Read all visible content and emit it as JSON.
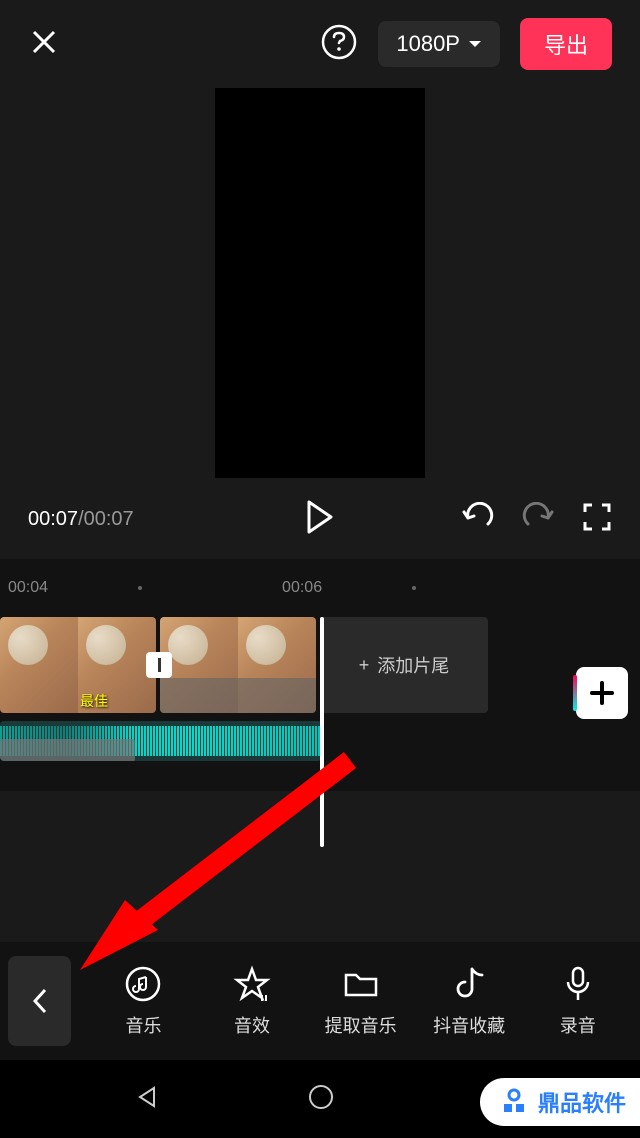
{
  "header": {
    "resolution": "1080P",
    "export_label": "导出"
  },
  "playback": {
    "current_time": "00:07",
    "total_time": "00:07"
  },
  "ruler": {
    "marks": [
      "00:04",
      "00:06"
    ]
  },
  "timeline": {
    "clip_overlay_text": "最佳",
    "add_ending_label": "添加片尾"
  },
  "toolbar": {
    "items": [
      {
        "icon": "music",
        "label": "音乐"
      },
      {
        "icon": "effects",
        "label": "音效"
      },
      {
        "icon": "extract",
        "label": "提取音乐"
      },
      {
        "icon": "douyin",
        "label": "抖音收藏"
      },
      {
        "icon": "record",
        "label": "录音"
      }
    ]
  },
  "watermark": {
    "text": "鼎品软件"
  }
}
